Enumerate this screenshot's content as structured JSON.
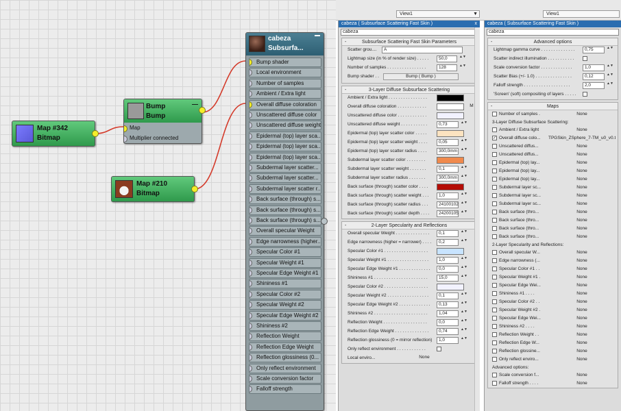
{
  "view_selectors": {
    "left": "View1",
    "right": "View1"
  },
  "nodes": {
    "map342": {
      "title": "Map #342",
      "subtitle": "Bitmap"
    },
    "map210": {
      "title": "Map #210",
      "subtitle": "Bitmap"
    },
    "bump": {
      "title": "Bump",
      "subtitle": "Bump",
      "slots": [
        "Map",
        "Multiplier connected"
      ],
      "collapse": "—"
    },
    "cabeza": {
      "title": "cabeza",
      "subtitle": "Subsurfa...",
      "slots": [
        "Bump shader",
        "Local environment",
        "Number of samples",
        "Ambient / Extra light",
        "Overall diffuse coloration",
        "Unscattered diffuse color",
        "Unscattered diffuse weight",
        "Epidermal (top) layer sca...",
        "Epidermal (top) layer sca...",
        "Epidermal (top) layer sca...",
        "Subdermal layer scatter...",
        "Subdermal layer scatter...",
        "Subdermal layer scatter r...",
        "Back surface (through) s...",
        "Back surface (through) s...",
        "Back surface (through) s...",
        "Overall specular Weight",
        "Edge narrowness (higher...",
        "Specular Color #1",
        "Specular Weight #1",
        "Specular Edge Weight #1",
        "Shininess #1",
        "Specular Color #2",
        "Specular Weight #2",
        "Specular Edge Weight #2",
        "Shininess #2",
        "Reflection Weight",
        "Reflection Edge Weight",
        "Reflection glossiness (0...",
        "Only reflect environment",
        "Scale conversion factor",
        "Falloff strength"
      ]
    }
  },
  "panel1": {
    "title": "cabeza  ( Subsurface Scattering Fast Skin )",
    "close": "x",
    "name": "cabeza",
    "params_title": "Subsurface Scattering Fast Skin Parameters",
    "scatter_group": {
      "label": "Scatter grou....",
      "value": "A"
    },
    "lightmap": {
      "label": "Lightmap size (in % of render size) . . . . .",
      "value": "50,0"
    },
    "samples": {
      "label": "Number of samples . . . . . . . . . . . . . . . .",
      "value": "128"
    },
    "bump_shader": {
      "label": "Bump shader . .",
      "value": "Bump  ( Bump )"
    },
    "diffuse_title": "3-Layer Diffuse Subsurface Scattering",
    "diffuse_rows": [
      {
        "label": "Ambient / Extra light . . . . . . . . . . . . . . . .",
        "type": "color",
        "color": "#000000"
      },
      {
        "label": "Overall diffuse coloration . . . . . . . . . . . .",
        "type": "color",
        "color": "#ffffff",
        "extra": "M"
      },
      {
        "label": "Unscattered diffuse color . . . . . . . . . . . .",
        "type": "color",
        "color": "#f2f2ff"
      },
      {
        "label": "Unscattered diffuse weight . . . . . . . . . . .",
        "type": "num",
        "value": "0,73"
      },
      {
        "label": "Epidermal (top) layer scatter color . . . . .",
        "type": "color",
        "color": "#fce3c0"
      },
      {
        "label": "Epidermal (top) layer scatter weight . . . .",
        "type": "num",
        "value": "0,05"
      },
      {
        "label": "Epidermal (top) layer scatter radius . . . .",
        "type": "num",
        "value": "300,0mm"
      },
      {
        "label": "Subdermal layer scatter color . . . . . . . .",
        "type": "color",
        "color": "#f08a4d"
      },
      {
        "label": "Subdermal layer scatter weight . . . . . . .",
        "type": "num",
        "value": "0,1"
      },
      {
        "label": "Subdermal layer scatter radius . . . . . . .",
        "type": "num",
        "value": "300,0mm"
      },
      {
        "label": "Back surface (through) scatter color . . . .",
        "type": "color",
        "color": "#b40d06"
      },
      {
        "label": "Back surface (through) scatter weight . . .",
        "type": "num",
        "value": "1,0"
      },
      {
        "label": "Back surface (through) scatter radius . . .",
        "type": "num",
        "value": "24100102"
      },
      {
        "label": "Back surface (through) scatter depth . . . .",
        "type": "num",
        "value": "24200105"
      }
    ],
    "spec_title": "2-Layer Specularity and Reflections",
    "spec_rows": [
      {
        "label": "Overall specular Weight . . . . . . . . . . . . . .",
        "type": "num",
        "value": "0,1"
      },
      {
        "label": "Edge narrowness (higher = narrower) . . . .",
        "type": "num",
        "value": "0,2"
      },
      {
        "label": "Specular Color #1 . . . . . . . . . . . . . . . . . .",
        "type": "color",
        "color": "#c8e4ff"
      },
      {
        "label": "Specular Weight #1 . . . . . . . . . . . . . . . . .",
        "type": "num",
        "value": "1,0"
      },
      {
        "label": "Specular Edge Weight #1 . . . . . . . . . . . . .",
        "type": "num",
        "value": "0,0"
      },
      {
        "label": "Shininess #1 . . . . . . . . . . . . . . . . . . . . . .",
        "type": "num",
        "value": "15,0"
      },
      {
        "label": "Specular Color #2 . . . . . . . . . . . . . . . . . .",
        "type": "color",
        "color": "#f2f2ff"
      },
      {
        "label": "Specular Weight #2 . . . . . . . . . . . . . . . . .",
        "type": "num",
        "value": "0,1"
      },
      {
        "label": "Specular Edge Weight #2 . . . . . . . . . . . . .",
        "type": "num",
        "value": "0,13"
      },
      {
        "label": "Shininess #2 . . . . . . . . . . . . . . . . . . . . . .",
        "type": "num",
        "value": "1,04"
      },
      {
        "label": "Reflection Weight . . . . . . . . . . . . . . . . . .",
        "type": "num",
        "value": "0,0"
      },
      {
        "label": "Reflection Edge Weight . . . . . . . . . . . . . .",
        "type": "num",
        "value": "0,74"
      },
      {
        "label": "Reflection glossiness (0 = mirror reflection)",
        "type": "num",
        "value": "1,0"
      },
      {
        "label": "Only reflect environment . . . . . . . . . . . .",
        "type": "check"
      }
    ],
    "local_env": {
      "label": "Local enviro...",
      "value": "None"
    }
  },
  "panel2": {
    "title": "cabeza  ( Subsurface Scattering Fast Skin )",
    "name": "cabeza",
    "adv_title": "Advanced options",
    "adv_rows": [
      {
        "label": "Lightmap gamma curve . . . . . . . . . . . . . .",
        "type": "num",
        "value": "0,75"
      },
      {
        "label": "Scatter indirect illumination . . . . . . . . . . .",
        "type": "check"
      },
      {
        "label": "Scale conversion factor . . . . . . . . . . . . .",
        "type": "num",
        "value": "1,0"
      },
      {
        "label": "Scatter Bias (+/- 1.0) . . . . . . . . . . . . . . .",
        "type": "num",
        "value": "0,12"
      },
      {
        "label": "Falloff strength . . . . . . . . . . . . . . . . . . .",
        "type": "num",
        "value": "2,0"
      },
      {
        "label": "'Screen' (soft) compositing of layers . . . . .",
        "type": "check"
      }
    ],
    "maps_title": "Maps",
    "maps": [
      {
        "type": "row",
        "label": "Number of samples .",
        "value": "None"
      },
      {
        "type": "head",
        "label": "3-Layer Diffuse Subsurface Scattering:"
      },
      {
        "type": "row",
        "label": "Ambient / Extra light",
        "value": "None"
      },
      {
        "type": "row",
        "label": "Overall diffuse colo...",
        "value": "TPGSkin_ZSphere_7-TM_u0_v0.tif)",
        "checked": true
      },
      {
        "type": "row",
        "label": "Unscattered diffus...",
        "value": "None"
      },
      {
        "type": "row",
        "label": "Unscattered diffus...",
        "value": "None"
      },
      {
        "type": "row",
        "label": "Epidermal (top) lay...",
        "value": "None"
      },
      {
        "type": "row",
        "label": "Epidermal (top) lay...",
        "value": "None"
      },
      {
        "type": "row",
        "label": "Epidermal (top) lay...",
        "value": "None"
      },
      {
        "type": "row",
        "label": "Subdermal layer sc...",
        "value": "None"
      },
      {
        "type": "row",
        "label": "Subdermal layer sc...",
        "value": "None"
      },
      {
        "type": "row",
        "label": "Subdermal layer sc...",
        "value": "None"
      },
      {
        "type": "row",
        "label": "Back surface (thro...",
        "value": "None"
      },
      {
        "type": "row",
        "label": "Back surface (thro...",
        "value": "None"
      },
      {
        "type": "row",
        "label": "Back surface (thro...",
        "value": "None"
      },
      {
        "type": "row",
        "label": "Back surface (thro...",
        "value": "None"
      },
      {
        "type": "head",
        "label": "2-Layer Specularity and Reflections:"
      },
      {
        "type": "row",
        "label": "Overall specular W...",
        "value": "None"
      },
      {
        "type": "row",
        "label": "Edge narrowness (...",
        "value": "None"
      },
      {
        "type": "row",
        "label": "Specular Color #1 . .",
        "value": "None"
      },
      {
        "type": "row",
        "label": "Specular Weight #1 .",
        "value": "None"
      },
      {
        "type": "row",
        "label": "Specular Edge Wei...",
        "value": "None"
      },
      {
        "type": "row",
        "label": "Shininess #1 . . . .",
        "value": "None"
      },
      {
        "type": "row",
        "label": "Specular Color #2 . .",
        "value": "None"
      },
      {
        "type": "row",
        "label": "Specular Weight #2 .",
        "value": "None"
      },
      {
        "type": "row",
        "label": "Specular Edge Wei...",
        "value": "None"
      },
      {
        "type": "row",
        "label": "Shininess #2 . . . .",
        "value": "None"
      },
      {
        "type": "row",
        "label": "Reflection Weight . .",
        "value": "None"
      },
      {
        "type": "row",
        "label": "Reflection Edge W...",
        "value": "None"
      },
      {
        "type": "row",
        "label": "Reflection glossine...",
        "value": "None"
      },
      {
        "type": "row",
        "label": "Only reflect enviro...",
        "value": "None"
      },
      {
        "type": "head",
        "label": "Advanced options:"
      },
      {
        "type": "row",
        "label": "Scale conversion f...",
        "value": "None"
      },
      {
        "type": "row",
        "label": "Falloff strength . . . .",
        "value": "None"
      }
    ]
  },
  "group_marker": "-"
}
